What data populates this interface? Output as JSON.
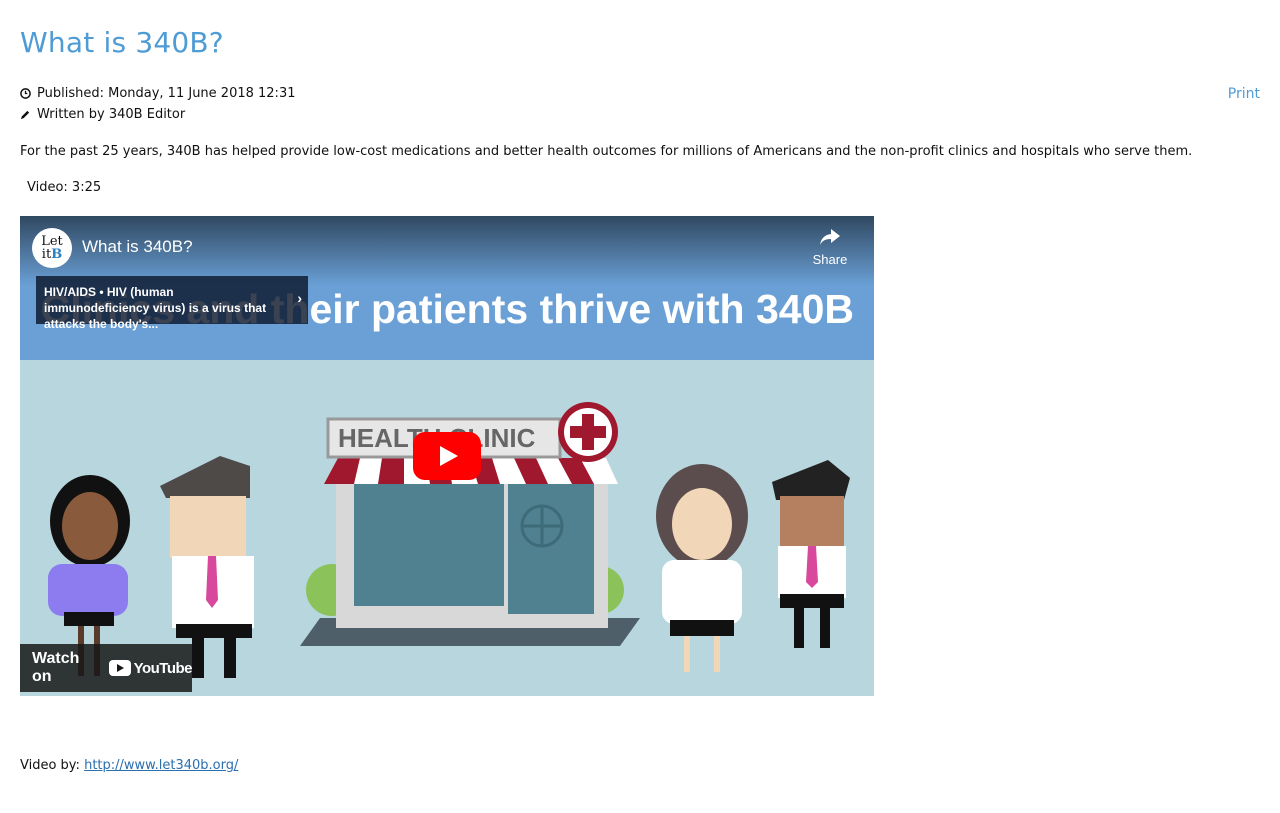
{
  "article": {
    "title": "What is 340B?",
    "published": "Published: Monday, 11 June 2018 12:31",
    "author": "Written by 340B Editor",
    "print_label": "Print",
    "intro": "For the past 25 years, 340B has helped provide low-cost medications and better health outcomes for millions of Americans and the non-profit clinics and hospitals who serve them.",
    "video_length": "Video: 3:25",
    "credit_label": "Video by:",
    "credit_link": "http://www.let340b.org/"
  },
  "video": {
    "channel_logo_line1": "Let",
    "channel_logo_line2": "it",
    "channel_logo_b": "B",
    "title": "What is 340B?",
    "share_label": "Share",
    "card_text": "HIV/AIDS • HIV (human immunodeficiency virus) is a virus that attacks the body's...",
    "banner_text": "Clinics and their patients thrive with 340B",
    "sign_text": "HEALTH CLINIC",
    "watch_label": "Watch on",
    "youtube_label": "YouTube"
  },
  "icons": {
    "clock": "clock-icon",
    "pencil": "pencil-icon",
    "share": "share-icon",
    "play": "play-icon",
    "chevron": "chevron-right-icon"
  },
  "colors": {
    "accent": "#4f9bd3",
    "link": "#2a6fae",
    "youtube_red": "#ff0000",
    "banner": "#6aa0d6",
    "scene_bg": "#b7d6de"
  }
}
